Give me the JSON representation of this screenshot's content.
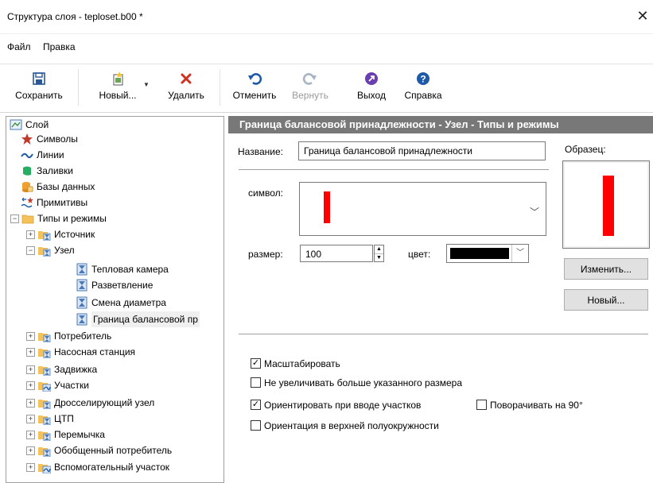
{
  "window": {
    "title": "Структура слоя - teploset.b00 *",
    "close_glyph": "✕"
  },
  "menu": [
    "Файл",
    "Правка"
  ],
  "toolbar": {
    "save": "Сохранить",
    "new": "Новый...",
    "delete": "Удалить",
    "undo": "Отменить",
    "redo": "Вернуть",
    "exit": "Выход",
    "help": "Справка"
  },
  "tree": {
    "items": [
      {
        "label": "Слой",
        "icon": "layer-icon"
      },
      {
        "label": "Символы",
        "icon": "star-icon"
      },
      {
        "label": "Линии",
        "icon": "line-icon"
      },
      {
        "label": "Заливки",
        "icon": "fill-icon"
      },
      {
        "label": "Базы данных",
        "icon": "database-icon"
      },
      {
        "label": "Примитивы",
        "icon": "primitives-icon"
      },
      {
        "label": "Типы и режимы",
        "icon": "folder-icon",
        "expander": "−"
      },
      {
        "label": "Источник",
        "icon": "type-folder-icon",
        "expander": "+"
      },
      {
        "label": "Узел",
        "icon": "type-folder-icon",
        "expander": "−"
      },
      {
        "label": "Тепловая камера",
        "icon": "hourglass-icon"
      },
      {
        "label": "Разветвление",
        "icon": "hourglass-icon"
      },
      {
        "label": "Смена диаметра",
        "icon": "hourglass-icon"
      },
      {
        "label": "Граница балансовой пр",
        "icon": "hourglass-icon"
      },
      {
        "label": "Потребитель",
        "icon": "type-folder-icon",
        "expander": "+"
      },
      {
        "label": "Насосная станция",
        "icon": "type-folder-icon",
        "expander": "+"
      },
      {
        "label": "Задвижка",
        "icon": "type-folder-icon",
        "expander": "+"
      },
      {
        "label": "Участки",
        "icon": "section-folder-icon",
        "expander": "+"
      },
      {
        "label": "Дросселирующий узел",
        "icon": "type-folder-icon",
        "expander": "+"
      },
      {
        "label": "ЦТП",
        "icon": "type-folder-icon",
        "expander": "+"
      },
      {
        "label": "Перемычка",
        "icon": "type-folder-icon",
        "expander": "+"
      },
      {
        "label": "Обобщенный потребитель",
        "icon": "type-folder-icon",
        "expander": "+"
      },
      {
        "label": "Вспомогательный участок",
        "icon": "section-folder-icon",
        "expander": "+"
      }
    ]
  },
  "panel": {
    "header": "Граница балансовой принадлежности - Узел - Типы и режимы",
    "name_label": "Название:",
    "name_value": "Граница балансовой принадлежности",
    "sample_label": "Образец:",
    "symbol_label": "символ:",
    "size_label": "размер:",
    "size_value": "100",
    "color_label": "цвет:",
    "symbol_color": "#ff0000",
    "line_color": "#000000",
    "change_button": "Изменить...",
    "new_button": "Новый...",
    "options": {
      "scale": {
        "label": "Масштабировать",
        "checked": true
      },
      "no_enlarge": {
        "label": "Не увеличивать больше указанного размера",
        "checked": false
      },
      "orient_input": {
        "label": "Ориентировать при вводе участков",
        "checked": true
      },
      "rotate90": {
        "label": "Поворачивать на 90°",
        "checked": false
      },
      "upper_semi": {
        "label": "Ориентация в верхней полуокружности",
        "checked": false
      }
    }
  }
}
